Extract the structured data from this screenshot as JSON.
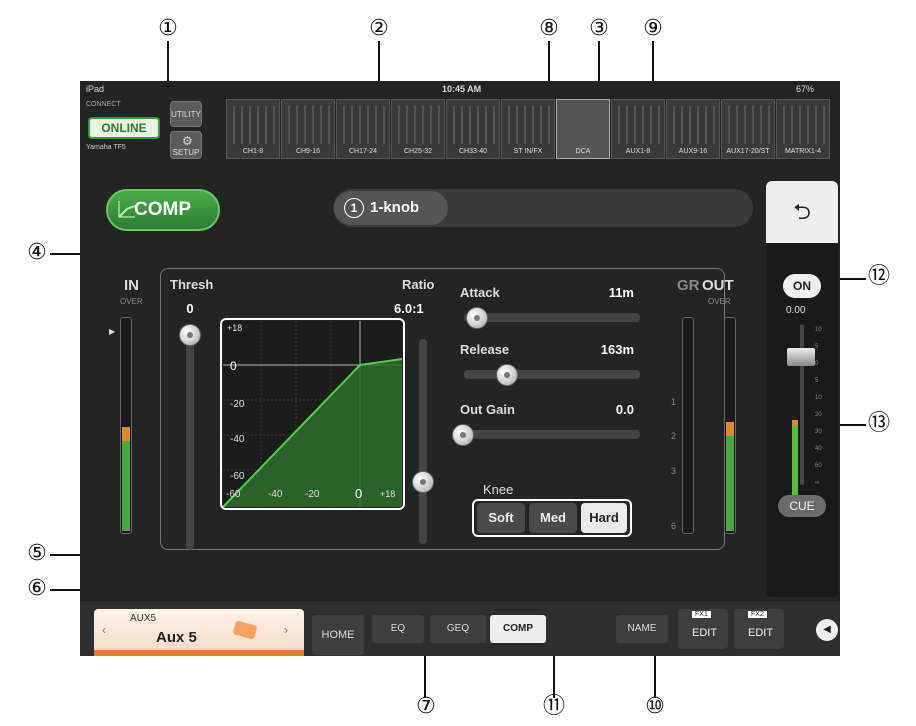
{
  "callouts": [
    "①",
    "②",
    "③",
    "④",
    "⑤",
    "⑥",
    "⑦",
    "⑧",
    "⑨",
    "⑩",
    "⑪",
    "⑫",
    "⑬"
  ],
  "status": {
    "device": "iPad ",
    "time": "10:45 AM",
    "battery": "67%"
  },
  "connect": {
    "label": "CONNECT",
    "online": "ONLINE",
    "model": "Yamaha TF5",
    "utility": "UTILITY",
    "setup": "SETUP"
  },
  "channel_bar": [
    "CH1-8",
    "CH9-16",
    "CH17-24",
    "CH25-32",
    "CH33-40",
    "ST IN/FX",
    "DCA",
    "AUX1-8",
    "AUX9-16",
    "AUX17-20/ST",
    "MATRIX1-4"
  ],
  "comp_button": "COMP",
  "preset": {
    "number": "1",
    "name": "1-knob"
  },
  "in_meter": {
    "label": "IN",
    "over": "OVER"
  },
  "thresh": {
    "label": "Thresh",
    "value": "0"
  },
  "ratio": {
    "label": "Ratio",
    "value": "6.0:1"
  },
  "graph": {
    "y_ticks": [
      "+18",
      "0",
      "-20",
      "-40",
      "-60"
    ],
    "x_ticks": [
      "-60",
      "-40",
      "-20",
      "0",
      "+18"
    ]
  },
  "attack": {
    "label": "Attack",
    "value": "11m",
    "level": 0.08
  },
  "release": {
    "label": "Release",
    "value": "163m",
    "level": 0.25
  },
  "out_gain": {
    "label": "Out Gain",
    "value": "0.0",
    "level": 0.0
  },
  "knee": {
    "label": "Knee",
    "options": [
      "Soft",
      "Med",
      "Hard"
    ],
    "selected": "Hard"
  },
  "gr_meter": {
    "label": "GR",
    "ticks": [
      "1",
      "2",
      "3",
      "6"
    ]
  },
  "out_meter": {
    "label": "OUT",
    "over": "OVER"
  },
  "fader": {
    "on": "ON",
    "level": "0.00",
    "cue": "CUE",
    "scale": [
      "10",
      "5",
      "0",
      "5",
      "10",
      "20",
      "30",
      "40",
      "60",
      "∞"
    ]
  },
  "bottom": {
    "ch_label": "AUX5",
    "ch_name": "Aux 5",
    "home": "HOME",
    "tabs": [
      "EQ",
      "GEQ",
      "COMP"
    ],
    "name": "NAME",
    "fx1": "FX1",
    "fx2": "FX2",
    "edit": "EDIT"
  },
  "colors": {
    "accent_green": "#3a9a3e",
    "meter_orange": "#e08a2a",
    "fader_green": "#5bbf3c"
  }
}
